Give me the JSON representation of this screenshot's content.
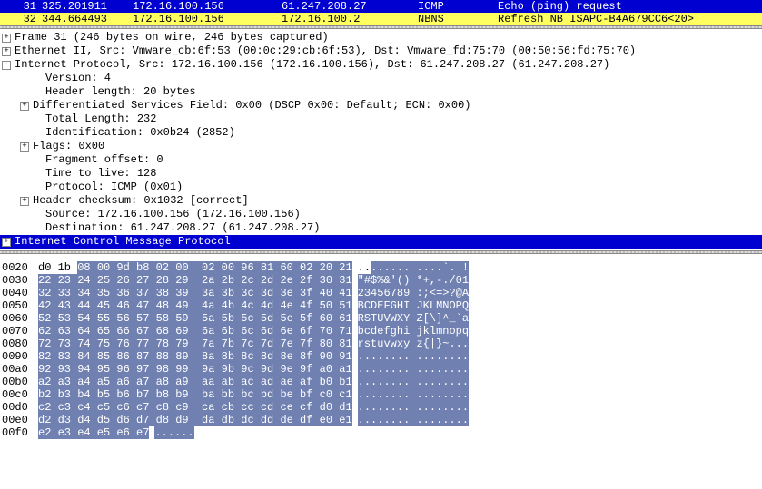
{
  "packet_list": {
    "rows": [
      {
        "no": "31",
        "time": "325.201911",
        "src": "172.16.100.156",
        "dst": "61.247.208.27",
        "prot": "ICMP",
        "info": "Echo (ping) request",
        "cls": "sel"
      },
      {
        "no": "32",
        "time": "344.664493",
        "src": "172.16.100.156",
        "dst": "172.16.100.2",
        "prot": "NBNS",
        "info": "Refresh NB ISAPC-B4A679CC6<20>",
        "cls": "other"
      }
    ]
  },
  "details": [
    {
      "exp": "+",
      "ind": 0,
      "text": "Frame 31 (246 bytes on wire, 246 bytes captured)"
    },
    {
      "exp": "+",
      "ind": 0,
      "text": "Ethernet II, Src: Vmware_cb:6f:53 (00:0c:29:cb:6f:53), Dst: Vmware_fd:75:70 (00:50:56:fd:75:70)"
    },
    {
      "exp": "-",
      "ind": 0,
      "text": "Internet Protocol, Src: 172.16.100.156 (172.16.100.156), Dst: 61.247.208.27 (61.247.208.27)"
    },
    {
      "exp": "",
      "ind": 1,
      "text": "Version: 4"
    },
    {
      "exp": "",
      "ind": 1,
      "text": "Header length: 20 bytes"
    },
    {
      "exp": "+",
      "ind": 1,
      "text": "Differentiated Services Field: 0x00 (DSCP 0x00: Default; ECN: 0x00)"
    },
    {
      "exp": "",
      "ind": 1,
      "text": "Total Length: 232"
    },
    {
      "exp": "",
      "ind": 1,
      "text": "Identification: 0x0b24 (2852)"
    },
    {
      "exp": "+",
      "ind": 1,
      "text": "Flags: 0x00"
    },
    {
      "exp": "",
      "ind": 1,
      "text": "Fragment offset: 0"
    },
    {
      "exp": "",
      "ind": 1,
      "text": "Time to live: 128"
    },
    {
      "exp": "",
      "ind": 1,
      "text": "Protocol: ICMP (0x01)"
    },
    {
      "exp": "+",
      "ind": 1,
      "text": "Header checksum: 0x1032 [correct]"
    },
    {
      "exp": "",
      "ind": 1,
      "text": "Source: 172.16.100.156 (172.16.100.156)"
    },
    {
      "exp": "",
      "ind": 1,
      "text": "Destination: 61.247.208.27 (61.247.208.27)"
    },
    {
      "exp": "+",
      "ind": 0,
      "text": "Internet Control Message Protocol",
      "sel": true
    }
  ],
  "hex": {
    "lines": [
      {
        "off": "0020",
        "bytes": "d0 1b 08 00 9d b8 02 00  02 00 96 81 60 02 20 21",
        "ascii": "........ ....`. !",
        "plain_bytes": 2,
        "plain_ascii": 2
      },
      {
        "off": "0030",
        "bytes": "22 23 24 25 26 27 28 29  2a 2b 2c 2d 2e 2f 30 31",
        "ascii": "\"#$%&'() *+,-./01",
        "plain_bytes": 0,
        "plain_ascii": 0
      },
      {
        "off": "0040",
        "bytes": "32 33 34 35 36 37 38 39  3a 3b 3c 3d 3e 3f 40 41",
        "ascii": "23456789 :;<=>?@A",
        "plain_bytes": 0,
        "plain_ascii": 0
      },
      {
        "off": "0050",
        "bytes": "42 43 44 45 46 47 48 49  4a 4b 4c 4d 4e 4f 50 51",
        "ascii": "BCDEFGHI JKLMNOPQ",
        "plain_bytes": 0,
        "plain_ascii": 0
      },
      {
        "off": "0060",
        "bytes": "52 53 54 55 56 57 58 59  5a 5b 5c 5d 5e 5f 60 61",
        "ascii": "RSTUVWXY Z[\\]^_`a",
        "plain_bytes": 0,
        "plain_ascii": 0
      },
      {
        "off": "0070",
        "bytes": "62 63 64 65 66 67 68 69  6a 6b 6c 6d 6e 6f 70 71",
        "ascii": "bcdefghi jklmnopq",
        "plain_bytes": 0,
        "plain_ascii": 0
      },
      {
        "off": "0080",
        "bytes": "72 73 74 75 76 77 78 79  7a 7b 7c 7d 7e 7f 80 81",
        "ascii": "rstuvwxy z{|}~...",
        "plain_bytes": 0,
        "plain_ascii": 0
      },
      {
        "off": "0090",
        "bytes": "82 83 84 85 86 87 88 89  8a 8b 8c 8d 8e 8f 90 91",
        "ascii": "........ ........",
        "plain_bytes": 0,
        "plain_ascii": 0
      },
      {
        "off": "00a0",
        "bytes": "92 93 94 95 96 97 98 99  9a 9b 9c 9d 9e 9f a0 a1",
        "ascii": "........ ........",
        "plain_bytes": 0,
        "plain_ascii": 0
      },
      {
        "off": "00b0",
        "bytes": "a2 a3 a4 a5 a6 a7 a8 a9  aa ab ac ad ae af b0 b1",
        "ascii": "........ ........",
        "plain_bytes": 0,
        "plain_ascii": 0
      },
      {
        "off": "00c0",
        "bytes": "b2 b3 b4 b5 b6 b7 b8 b9  ba bb bc bd be bf c0 c1",
        "ascii": "........ ........",
        "plain_bytes": 0,
        "plain_ascii": 0
      },
      {
        "off": "00d0",
        "bytes": "c2 c3 c4 c5 c6 c7 c8 c9  ca cb cc cd ce cf d0 d1",
        "ascii": "........ ........",
        "plain_bytes": 0,
        "plain_ascii": 0
      },
      {
        "off": "00e0",
        "bytes": "d2 d3 d4 d5 d6 d7 d8 d9  da db dc dd de df e0 e1",
        "ascii": "........ ........",
        "plain_bytes": 0,
        "plain_ascii": 0
      },
      {
        "off": "00f0",
        "bytes": "e2 e3 e4 e5 e6 e7",
        "ascii": "......",
        "plain_bytes": 0,
        "plain_ascii": 0
      }
    ]
  }
}
